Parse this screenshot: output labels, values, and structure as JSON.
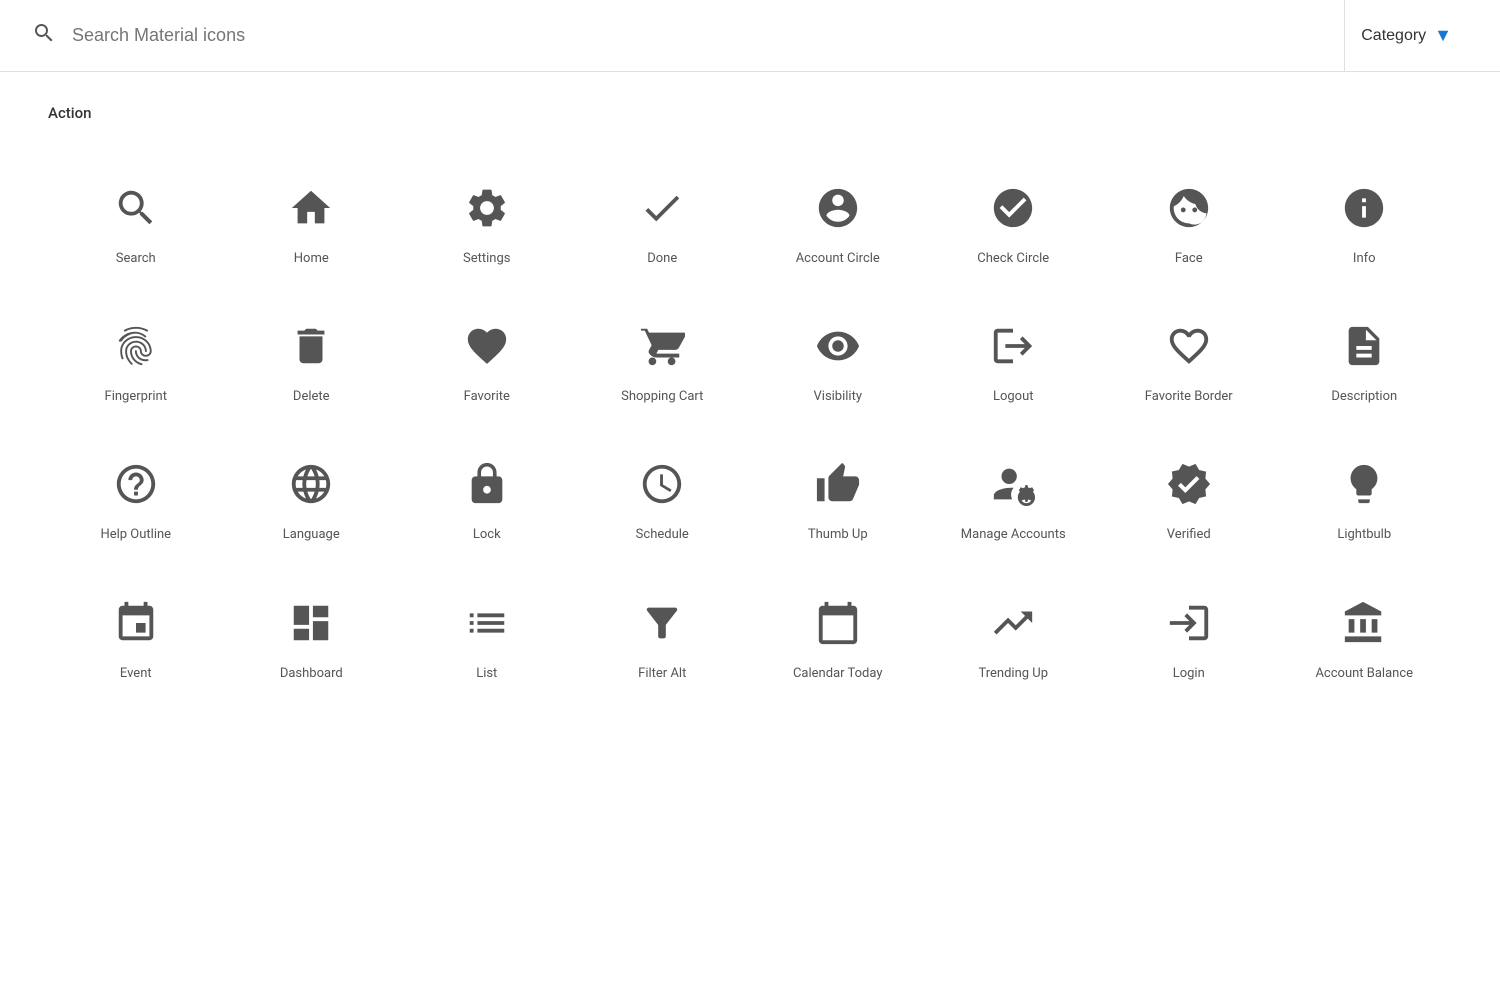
{
  "header": {
    "search_placeholder": "Search Material icons",
    "category_label": "Category"
  },
  "section": {
    "title": "Action"
  },
  "icons": [
    {
      "id": "search",
      "label": "Search"
    },
    {
      "id": "home",
      "label": "Home"
    },
    {
      "id": "settings",
      "label": "Settings"
    },
    {
      "id": "done",
      "label": "Done"
    },
    {
      "id": "account_circle",
      "label": "Account Circle"
    },
    {
      "id": "check_circle",
      "label": "Check Circle"
    },
    {
      "id": "face",
      "label": "Face"
    },
    {
      "id": "info",
      "label": "Info"
    },
    {
      "id": "fingerprint",
      "label": "Fingerprint"
    },
    {
      "id": "delete",
      "label": "Delete"
    },
    {
      "id": "favorite",
      "label": "Favorite"
    },
    {
      "id": "shopping_cart",
      "label": "Shopping Cart"
    },
    {
      "id": "visibility",
      "label": "Visibility"
    },
    {
      "id": "logout",
      "label": "Logout"
    },
    {
      "id": "favorite_border",
      "label": "Favorite Border"
    },
    {
      "id": "description",
      "label": "Description"
    },
    {
      "id": "help_outline",
      "label": "Help Outline"
    },
    {
      "id": "language",
      "label": "Language"
    },
    {
      "id": "lock",
      "label": "Lock"
    },
    {
      "id": "schedule",
      "label": "Schedule"
    },
    {
      "id": "thumb_up",
      "label": "Thumb Up"
    },
    {
      "id": "manage_accounts",
      "label": "Manage Accounts"
    },
    {
      "id": "verified",
      "label": "Verified"
    },
    {
      "id": "lightbulb",
      "label": "Lightbulb"
    },
    {
      "id": "event",
      "label": "Event"
    },
    {
      "id": "dashboard",
      "label": "Dashboard"
    },
    {
      "id": "list",
      "label": "List"
    },
    {
      "id": "filter_alt",
      "label": "Filter Alt"
    },
    {
      "id": "calendar_today",
      "label": "Calendar Today"
    },
    {
      "id": "trending_up",
      "label": "Trending Up"
    },
    {
      "id": "login",
      "label": "Login"
    },
    {
      "id": "account_balance",
      "label": "Account Balance"
    }
  ]
}
